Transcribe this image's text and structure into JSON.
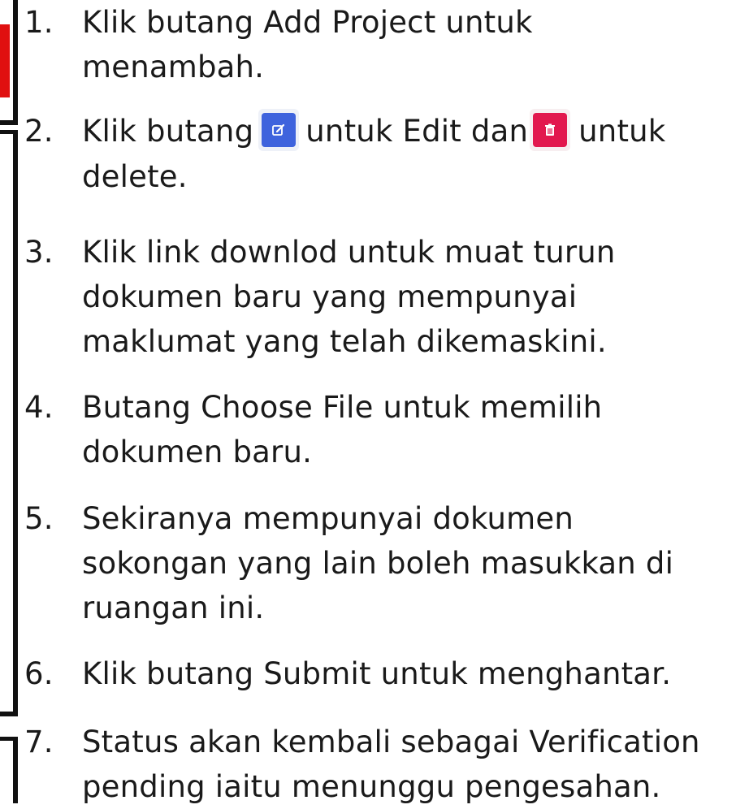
{
  "steps": [
    {
      "num": "1.",
      "lines": [
        "Klik butang Add Project untuk",
        "menambah."
      ]
    },
    {
      "num": "2.",
      "line1_a": "Klik butang",
      "line1_b": "untuk Edit dan",
      "line1_c": "untuk",
      "lines_rest": [
        "delete."
      ]
    },
    {
      "num": "3.",
      "lines": [
        "Klik link downlod untuk muat turun",
        "dokumen baru yang mempunyai",
        "maklumat yang telah dikemaskini."
      ]
    },
    {
      "num": "4.",
      "lines": [
        "Butang Choose File untuk memilih",
        "dokumen baru."
      ]
    },
    {
      "num": "5.",
      "lines": [
        "Sekiranya mempunyai dokumen",
        "sokongan yang lain boleh masukkan di",
        "ruangan ini."
      ]
    },
    {
      "num": "6.",
      "lines": [
        "Klik butang Submit untuk menghantar."
      ]
    },
    {
      "num": "7.",
      "lines": [
        "Status akan kembali sebagai Verification",
        "pending iaitu menunggu pengesahan."
      ]
    }
  ],
  "icons": {
    "edit": "edit-icon",
    "delete": "trash-icon"
  },
  "colors": {
    "edit_button": "#3e63dd",
    "delete_button": "#e2184e",
    "callout_red": "#e01010",
    "frame": "#111111"
  }
}
